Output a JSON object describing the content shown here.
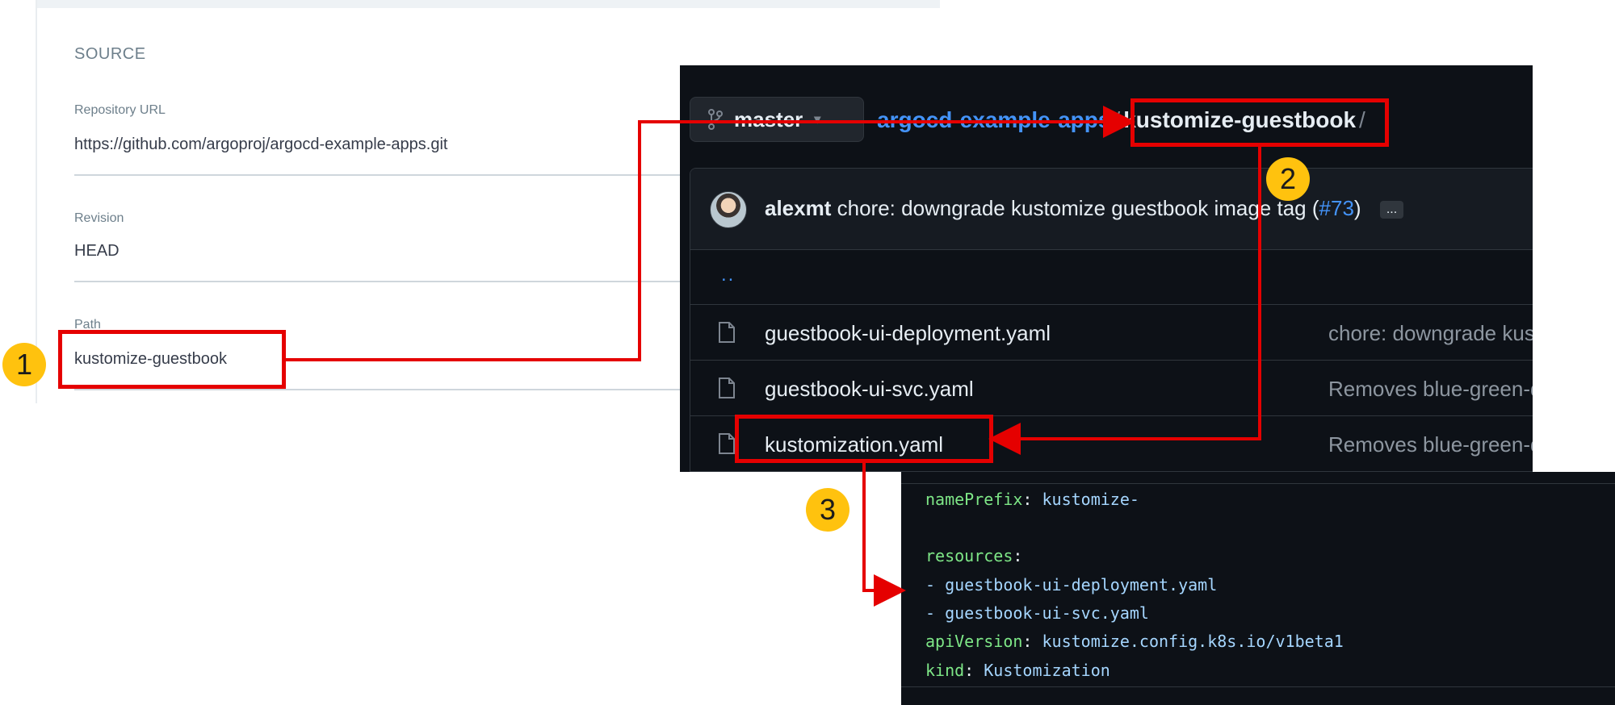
{
  "argo": {
    "section_title": "SOURCE",
    "repo_label": "Repository URL",
    "repo_value": "https://github.com/argoproj/argocd-example-apps.git",
    "revision_label": "Revision",
    "revision_value": "HEAD",
    "path_label": "Path",
    "path_value": "kustomize-guestbook"
  },
  "github": {
    "branch": "master",
    "breadcrumb_repo": "argocd-example-apps",
    "breadcrumb_sep": "/",
    "breadcrumb_current": "kustomize-guestbook",
    "breadcrumb_trailing": "/",
    "commit_author": "alexmt",
    "commit_message": "chore: downgrade kustomize guestbook image tag (",
    "commit_pr": "#73",
    "commit_close": ")",
    "commit_more": "...",
    "parent_dir": "..",
    "files": [
      {
        "name": "guestbook-ui-deployment.yaml",
        "commit": "chore: downgrade kus"
      },
      {
        "name": "guestbook-ui-svc.yaml",
        "commit": "Removes blue-green-d"
      },
      {
        "name": "kustomization.yaml",
        "commit": "Removes blue-green-d"
      }
    ]
  },
  "code": {
    "line1_key": "namePrefix",
    "line1_val": "kustomize-",
    "line2_key": "resources",
    "line3_val": "- guestbook-ui-deployment.yaml",
    "line4_val": "- guestbook-ui-svc.yaml",
    "line5_key": "apiVersion",
    "line5_val": "kustomize.config.k8s.io/v1beta1",
    "line6_key": "kind",
    "line6_val": "Kustomization"
  },
  "annotations": {
    "step1": "1",
    "step2": "2",
    "step3": "3",
    "highlight_color": "#e50000",
    "badge_color": "#ffc20e"
  }
}
